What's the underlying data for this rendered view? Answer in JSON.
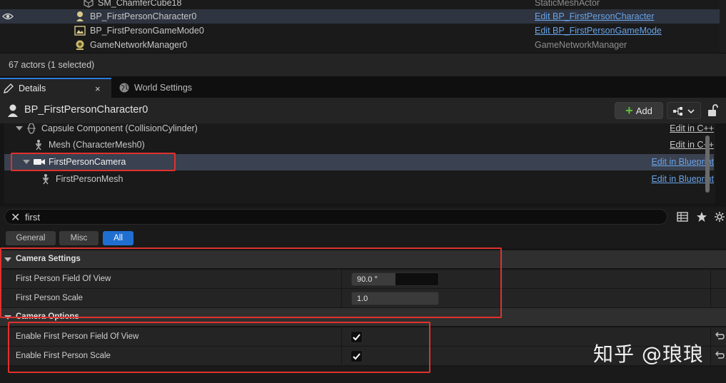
{
  "outliner": {
    "rows": [
      {
        "name": "SM_ChamferCube18",
        "type": "StaticMeshActor",
        "selected": false,
        "type_is_link": false
      },
      {
        "name": "BP_FirstPersonCharacter0",
        "type": "Edit BP_FirstPersonCharacter",
        "selected": true,
        "type_is_link": true
      },
      {
        "name": "BP_FirstPersonGameMode0",
        "type": "Edit BP_FirstPersonGameMode",
        "selected": false,
        "type_is_link": true
      },
      {
        "name": "GameNetworkManager0",
        "type": "GameNetworkManager",
        "selected": false,
        "type_is_link": false
      }
    ],
    "actor_count": "67 actors (1 selected)"
  },
  "tabs": {
    "details": "Details",
    "world_settings": "World Settings",
    "close": "×"
  },
  "actor": {
    "name": "BP_FirstPersonCharacter0",
    "add_label": "Add"
  },
  "components": [
    {
      "name": "Capsule Component (CollisionCylinder)",
      "edit": "Edit in C++"
    },
    {
      "name": "Mesh (CharacterMesh0)",
      "edit": "Edit in C++"
    },
    {
      "name": "FirstPersonCamera",
      "edit": "Edit in Blueprint"
    },
    {
      "name": "FirstPersonMesh",
      "edit": "Edit in Blueprint"
    }
  ],
  "search": {
    "value": "first"
  },
  "filters": [
    "General",
    "Misc",
    "All"
  ],
  "sections": {
    "camera_settings": {
      "title": "Camera Settings",
      "props": [
        {
          "label": "First Person Field Of View",
          "value": "90.0 °",
          "fill": 0.5
        },
        {
          "label": "First Person Scale",
          "value": "1.0",
          "fill": 0
        }
      ]
    },
    "camera_options": {
      "title": "Camera Options",
      "props": [
        {
          "label": "Enable First Person Field Of View",
          "checked": true
        },
        {
          "label": "Enable First Person Scale",
          "checked": true
        }
      ]
    }
  },
  "watermark": "知乎 @琅琅",
  "colors": {
    "accent": "#1f6fd0",
    "link": "#6aa4e8",
    "highlight": "#e0312d"
  }
}
